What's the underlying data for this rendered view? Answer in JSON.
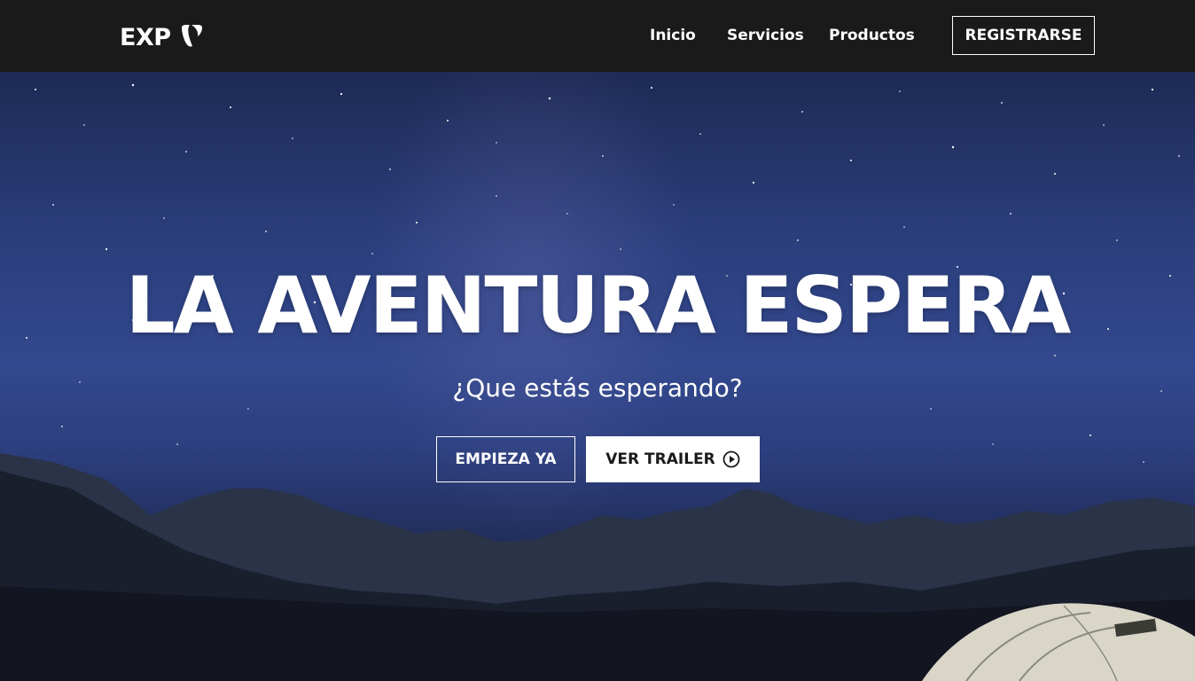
{
  "header": {
    "brand": "EXP",
    "brand_icon": "typo3-logo-icon",
    "nav": [
      "Inicio",
      "Servicios",
      "Productos"
    ],
    "register_label": "REGISTRARSE"
  },
  "hero": {
    "title": "LA AVENTURA ESPERA",
    "subtitle": "¿Que estás esperando?",
    "primary_button": "EMPIEZA YA",
    "secondary_button": "VER TRAILER",
    "secondary_icon": "play-circle-icon"
  },
  "colors": {
    "nav_bg": "#1b1a1b",
    "sky_mid": "#33488e",
    "text": "#ffffff"
  }
}
